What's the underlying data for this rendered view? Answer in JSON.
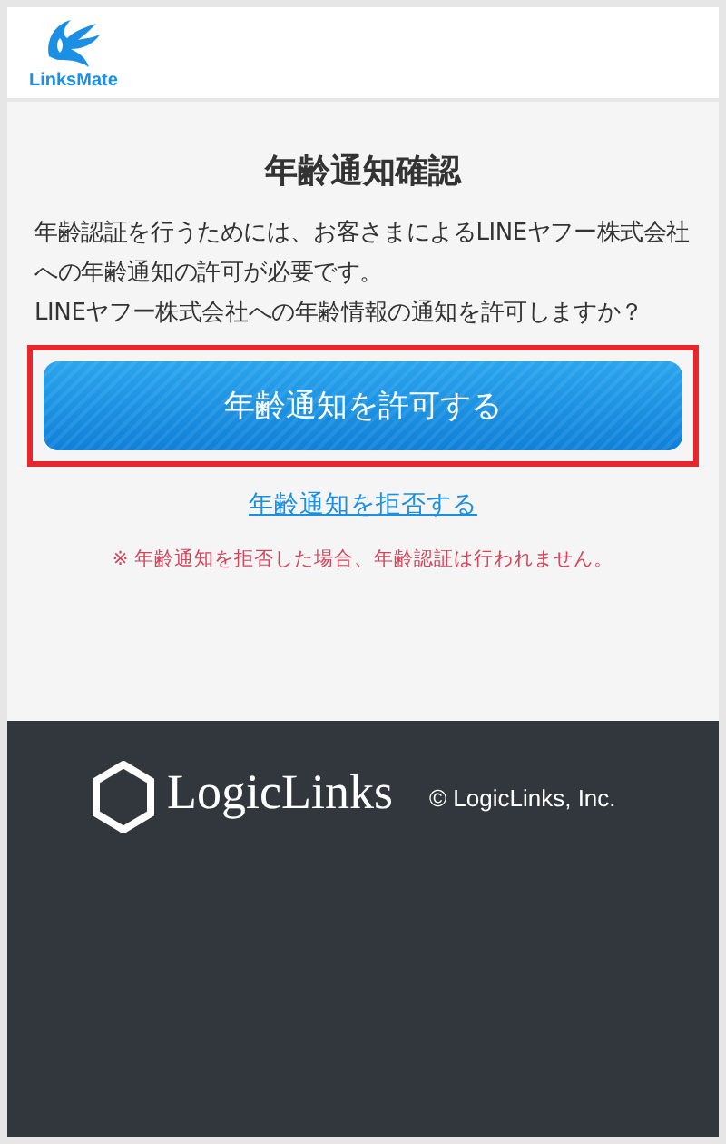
{
  "header": {
    "logo_text": "LinksMate"
  },
  "dialog": {
    "title": "年齢通知確認",
    "message": [
      "年齢認証を行うためには、お客さまによるLINEヤフー株式会社への年齢通知の許可が必要です。",
      "LINEヤフー株式会社への年齢情報の通知を許可しますか？"
    ],
    "allow_button": {
      "label": "年齢通知を許可する",
      "highlighted": true
    },
    "deny_link": "年齢通知を拒否する",
    "note": "※ 年齢通知を拒否した場合、年齢認証は行われません。"
  },
  "footer": {
    "logo_text": "LogicLinks",
    "copyright": "© LogicLinks, Inc."
  }
}
